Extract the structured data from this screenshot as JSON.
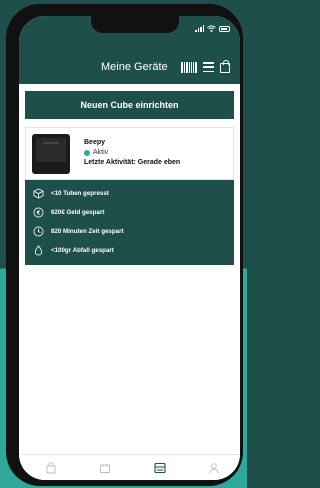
{
  "header": {
    "title": "Meine Geräte",
    "icons": [
      "barcode-icon",
      "menu-icon",
      "bag-icon"
    ]
  },
  "cta": {
    "label": "Neuen Cube einrichten"
  },
  "device": {
    "name": "Beepy",
    "status": "Aktiv",
    "activity": "Letzte Aktivität: Gerade eben",
    "image": "cube-device-image"
  },
  "stats": [
    {
      "icon": "cube-icon",
      "text": "<10 Tuben gepresst"
    },
    {
      "icon": "euro-icon",
      "text": "620€ Geld gespart"
    },
    {
      "icon": "clock-icon",
      "text": "820 Minuten Zeit gespart"
    },
    {
      "icon": "drop-icon",
      "text": "<100gr Abfall gespart"
    }
  ],
  "tabbar": {
    "tabs": [
      "shop-tab",
      "cart-tab",
      "devices-tab",
      "profile-tab"
    ],
    "active": "devices-tab"
  },
  "colors": {
    "primary": "#1e4f4a",
    "accent": "#2fa89a",
    "inactive_tab": "#bdbdbd"
  }
}
